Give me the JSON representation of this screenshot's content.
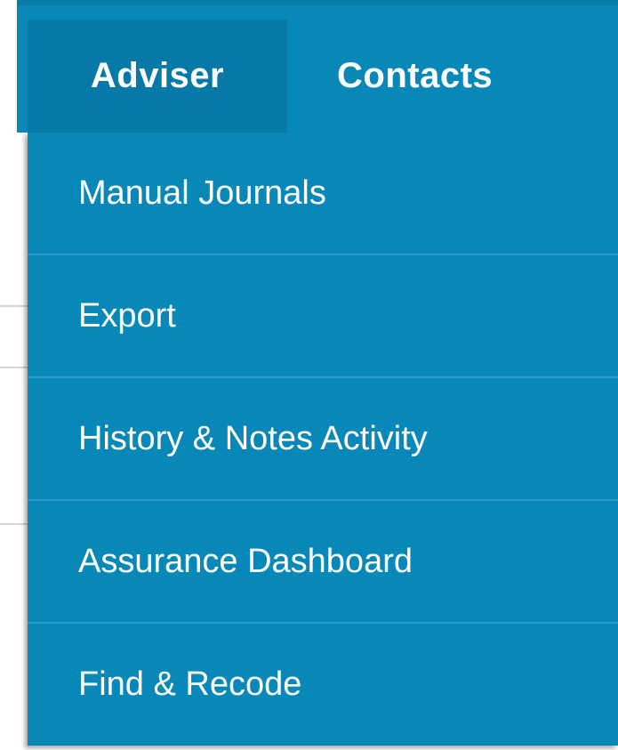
{
  "navbar": {
    "tabs": [
      {
        "label": "Adviser",
        "active": true
      },
      {
        "label": "Contacts",
        "active": false
      }
    ]
  },
  "adviser_menu": {
    "items": [
      {
        "label": "Manual Journals"
      },
      {
        "label": "Export"
      },
      {
        "label": "History & Notes Activity"
      },
      {
        "label": "Assurance Dashboard"
      },
      {
        "label": "Find & Recode"
      }
    ]
  },
  "colors": {
    "bar": "#0788b8",
    "active_tab": "#0679a6",
    "separator": "#2a9bc6",
    "text": "#ffffff"
  }
}
